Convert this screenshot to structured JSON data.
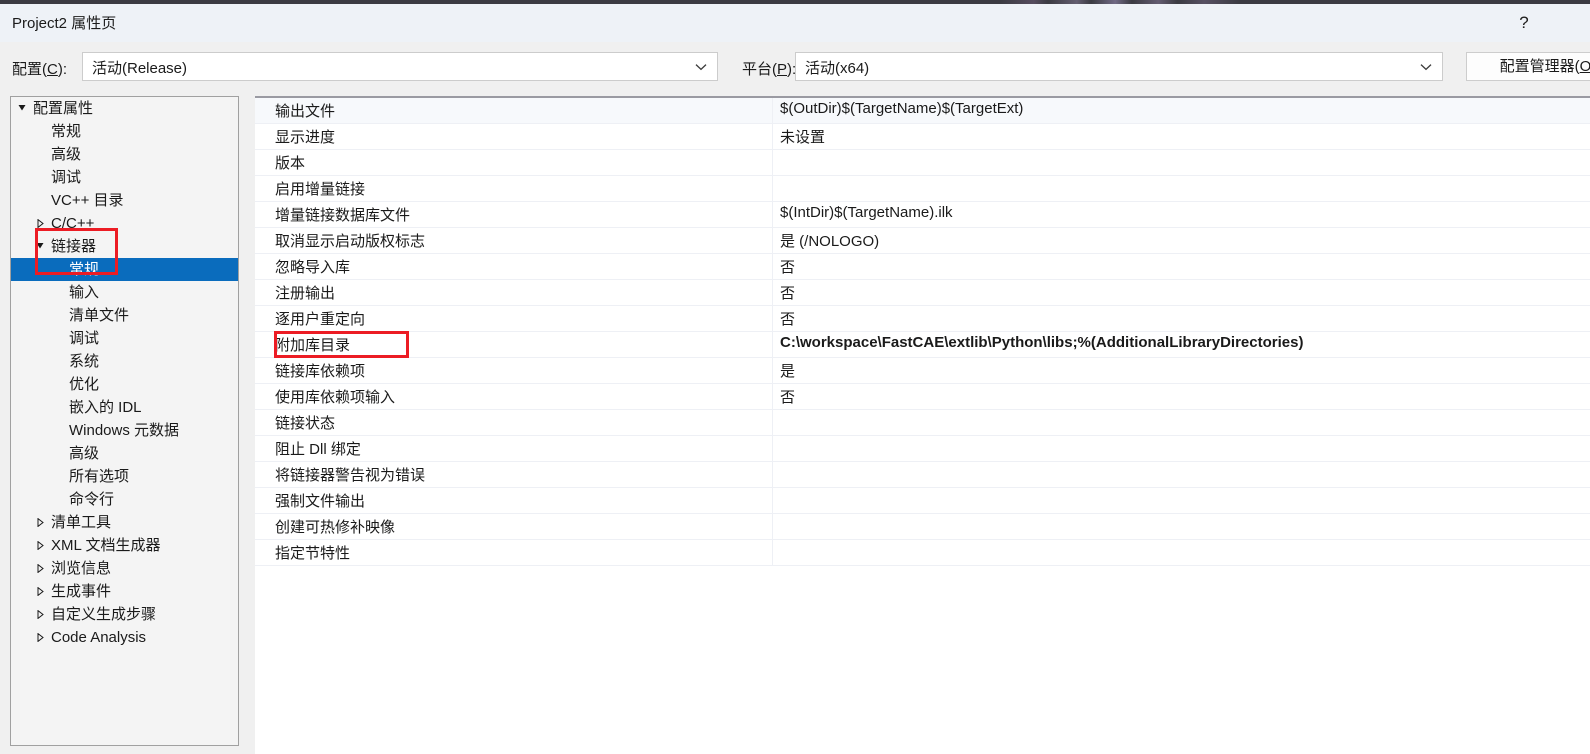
{
  "window": {
    "title": "Project2 属性页",
    "help_icon": "?"
  },
  "configbar": {
    "configuration_label": "配置(C):",
    "configuration_label_prefix": "配置(",
    "configuration_mnemonic": "C",
    "configuration_label_suffix": "):",
    "configuration_value": "活动(Release)",
    "platform_label_prefix": "平台(",
    "platform_mnemonic": "P",
    "platform_label_suffix": "):",
    "platform_value": "活动(x64)",
    "config_manager_prefix": "配置管理器(",
    "config_manager_mnemonic": "O",
    "config_manager_suffix": ")"
  },
  "tree": {
    "items": [
      {
        "label": "配置属性",
        "level": 0,
        "twisty": "expanded",
        "selected": false
      },
      {
        "label": "常规",
        "level": 1,
        "twisty": "none",
        "selected": false
      },
      {
        "label": "高级",
        "level": 1,
        "twisty": "none",
        "selected": false
      },
      {
        "label": "调试",
        "level": 1,
        "twisty": "none",
        "selected": false
      },
      {
        "label": "VC++ 目录",
        "level": 1,
        "twisty": "none",
        "selected": false
      },
      {
        "label": "C/C++",
        "level": 1,
        "twisty": "collapsed",
        "selected": false
      },
      {
        "label": "链接器",
        "level": 1,
        "twisty": "expanded",
        "selected": false
      },
      {
        "label": "常规",
        "level": 2,
        "twisty": "none",
        "selected": true
      },
      {
        "label": "输入",
        "level": 2,
        "twisty": "none",
        "selected": false
      },
      {
        "label": "清单文件",
        "level": 2,
        "twisty": "none",
        "selected": false
      },
      {
        "label": "调试",
        "level": 2,
        "twisty": "none",
        "selected": false
      },
      {
        "label": "系统",
        "level": 2,
        "twisty": "none",
        "selected": false
      },
      {
        "label": "优化",
        "level": 2,
        "twisty": "none",
        "selected": false
      },
      {
        "label": "嵌入的 IDL",
        "level": 2,
        "twisty": "none",
        "selected": false
      },
      {
        "label": "Windows 元数据",
        "level": 2,
        "twisty": "none",
        "selected": false
      },
      {
        "label": "高级",
        "level": 2,
        "twisty": "none",
        "selected": false
      },
      {
        "label": "所有选项",
        "level": 2,
        "twisty": "none",
        "selected": false
      },
      {
        "label": "命令行",
        "level": 2,
        "twisty": "none",
        "selected": false
      },
      {
        "label": "清单工具",
        "level": 1,
        "twisty": "collapsed",
        "selected": false
      },
      {
        "label": "XML 文档生成器",
        "level": 1,
        "twisty": "collapsed",
        "selected": false
      },
      {
        "label": "浏览信息",
        "level": 1,
        "twisty": "collapsed",
        "selected": false
      },
      {
        "label": "生成事件",
        "level": 1,
        "twisty": "collapsed",
        "selected": false
      },
      {
        "label": "自定义生成步骤",
        "level": 1,
        "twisty": "collapsed",
        "selected": false
      },
      {
        "label": "Code Analysis",
        "level": 1,
        "twisty": "collapsed",
        "selected": false
      }
    ]
  },
  "properties": {
    "rows": [
      {
        "name": "输出文件",
        "value": "$(OutDir)$(TargetName)$(TargetExt)",
        "bold": false
      },
      {
        "name": "显示进度",
        "value": "未设置",
        "bold": false
      },
      {
        "name": "版本",
        "value": "",
        "bold": false
      },
      {
        "name": "启用增量链接",
        "value": "",
        "bold": false
      },
      {
        "name": "增量链接数据库文件",
        "value": "$(IntDir)$(TargetName).ilk",
        "bold": false
      },
      {
        "name": "取消显示启动版权标志",
        "value": "是 (/NOLOGO)",
        "bold": false
      },
      {
        "name": "忽略导入库",
        "value": "否",
        "bold": false
      },
      {
        "name": "注册输出",
        "value": "否",
        "bold": false
      },
      {
        "name": "逐用户重定向",
        "value": "否",
        "bold": false
      },
      {
        "name": "附加库目录",
        "value": "C:\\workspace\\FastCAE\\extlib\\Python\\libs;%(AdditionalLibraryDirectories)",
        "bold": true
      },
      {
        "name": "链接库依赖项",
        "value": "是",
        "bold": false
      },
      {
        "name": "使用库依赖项输入",
        "value": "否",
        "bold": false
      },
      {
        "name": "链接状态",
        "value": "",
        "bold": false
      },
      {
        "name": "阻止 Dll 绑定",
        "value": "",
        "bold": false
      },
      {
        "name": "将链接器警告视为错误",
        "value": "",
        "bold": false
      },
      {
        "name": "强制文件输出",
        "value": "",
        "bold": false
      },
      {
        "name": "创建可热修补映像",
        "value": "",
        "bold": false
      },
      {
        "name": "指定节特性",
        "value": "",
        "bold": false
      }
    ]
  },
  "annotations": {
    "highlight_color": "#ec1c24",
    "boxes": [
      {
        "target": "链接器 / 常规"
      },
      {
        "target": "附加库目录"
      }
    ]
  },
  "colors": {
    "selection": "#0a6cbd",
    "titlebar": "#eef2f7",
    "body": "#f0f0f0",
    "grid_bg": "#ffffff"
  }
}
